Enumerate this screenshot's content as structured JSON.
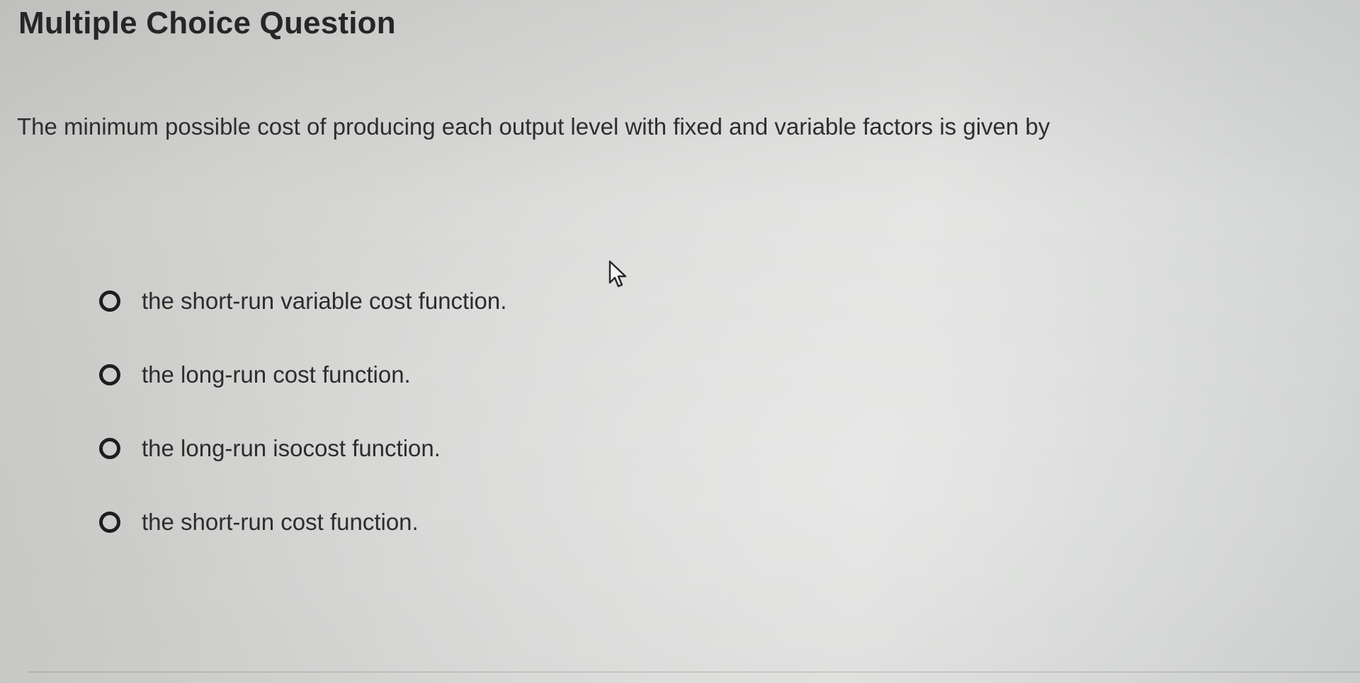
{
  "question": {
    "header": "Multiple Choice Question",
    "prompt": "The minimum possible cost of producing each output level with fixed and variable factors is given by",
    "options": [
      {
        "label": "the short-run variable cost function."
      },
      {
        "label": "the long-run cost function."
      },
      {
        "label": "the long-run isocost function."
      },
      {
        "label": "the short-run cost function."
      }
    ]
  },
  "icons": {
    "pointer": "mouse-pointer-icon",
    "radio": "radio-unselected-icon"
  },
  "colors": {
    "text": "#2b2b2b",
    "radio_border": "#1e1e1e",
    "background": "#d8d9d7"
  }
}
